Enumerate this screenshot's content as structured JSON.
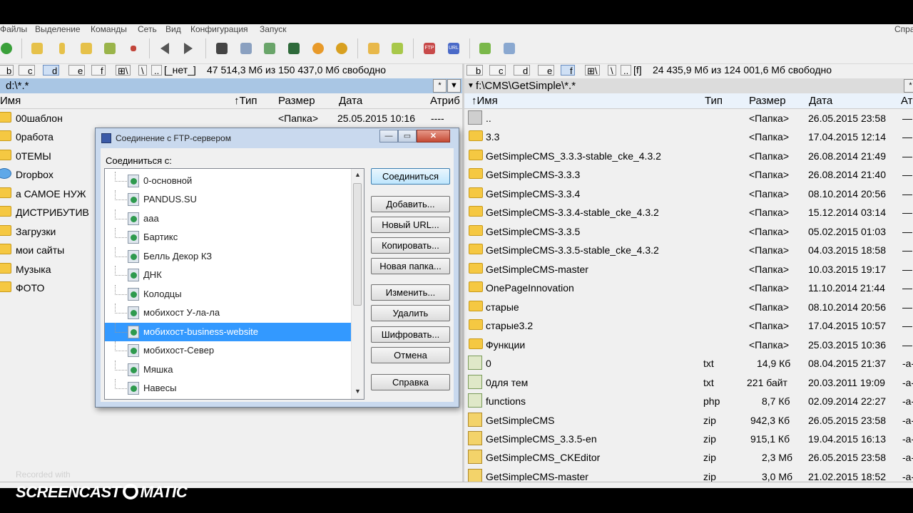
{
  "menu": {
    "items": [
      "Файлы",
      "Выделение",
      "Команды",
      "Сеть",
      "Вид",
      "Конфигурация",
      "Запуск"
    ],
    "right": "Спра"
  },
  "left_panel": {
    "drives": [
      "b",
      "c",
      "d",
      "e",
      "f"
    ],
    "selected_drive": "d",
    "drive_label": "[_нет_]",
    "free_space": "47 514,3 Мб из 150 437,0 Мб свободно",
    "path": "d:\\*.*",
    "history_btn": "*",
    "dropdown_btn": "▼",
    "columns": {
      "name": "Имя",
      "ext": "↑Тип",
      "size": "Размер",
      "date": "Дата",
      "attr": "Атриб"
    },
    "rows": [
      {
        "name": "00шаблон",
        "size": "<Папка>",
        "date": "25.05.2015 10:16",
        "attr": "----"
      },
      {
        "name": "0работа"
      },
      {
        "name": "0ТЕМЫ"
      },
      {
        "name": "Dropbox"
      },
      {
        "name": "а САМОЕ НУЖ"
      },
      {
        "name": "ДИСТРИБУТИВ"
      },
      {
        "name": "Загрузки"
      },
      {
        "name": "мои сайты"
      },
      {
        "name": "Музыка"
      },
      {
        "name": "ФОТО"
      }
    ]
  },
  "right_panel": {
    "drives": [
      "b",
      "c",
      "d",
      "e",
      "f"
    ],
    "selected_drive": "f",
    "drive_label": "[f]",
    "free_space": "24 435,9 Мб из 124 001,6 Мб свободно",
    "path": "f:\\CMS\\GetSimple\\*.*",
    "columns": {
      "name": "↑Имя",
      "ext": "Тип",
      "size": "Размер",
      "date": "Дата",
      "attr": "Ат"
    },
    "rows": [
      {
        "icon": "up",
        "name": "..",
        "ext": "",
        "size": "<Папка>",
        "date": "26.05.2015 23:58",
        "attr": "—"
      },
      {
        "icon": "folder",
        "name": "3.3",
        "ext": "",
        "size": "<Папка>",
        "date": "17.04.2015 12:14",
        "attr": "—"
      },
      {
        "icon": "folder",
        "name": "GetSimpleCMS_3.3.3-stable_cke_4.3.2",
        "ext": "",
        "size": "<Папка>",
        "date": "26.08.2014 21:49",
        "attr": "—"
      },
      {
        "icon": "folder",
        "name": "GetSimpleCMS-3.3.3",
        "ext": "",
        "size": "<Папка>",
        "date": "26.08.2014 21:40",
        "attr": "—"
      },
      {
        "icon": "folder",
        "name": "GetSimpleCMS-3.3.4",
        "ext": "",
        "size": "<Папка>",
        "date": "08.10.2014 20:56",
        "attr": "—"
      },
      {
        "icon": "folder",
        "name": "GetSimpleCMS-3.3.4-stable_cke_4.3.2",
        "ext": "",
        "size": "<Папка>",
        "date": "15.12.2014 03:14",
        "attr": "—"
      },
      {
        "icon": "folder",
        "name": "GetSimpleCMS-3.3.5",
        "ext": "",
        "size": "<Папка>",
        "date": "05.02.2015 01:03",
        "attr": "—"
      },
      {
        "icon": "folder",
        "name": "GetSimpleCMS-3.3.5-stable_cke_4.3.2",
        "ext": "",
        "size": "<Папка>",
        "date": "04.03.2015 18:58",
        "attr": "—"
      },
      {
        "icon": "folder",
        "name": "GetSimpleCMS-master",
        "ext": "",
        "size": "<Папка>",
        "date": "10.03.2015 19:17",
        "attr": "—"
      },
      {
        "icon": "folder",
        "name": "OnePageInnovation",
        "ext": "",
        "size": "<Папка>",
        "date": "11.10.2014 21:44",
        "attr": "—"
      },
      {
        "icon": "folder",
        "name": "старые",
        "ext": "",
        "size": "<Папка>",
        "date": "08.10.2014 20:56",
        "attr": "—"
      },
      {
        "icon": "folder",
        "name": "старые3.2",
        "ext": "",
        "size": "<Папка>",
        "date": "17.04.2015 10:57",
        "attr": "—"
      },
      {
        "icon": "folder",
        "name": "Функции",
        "ext": "",
        "size": "<Папка>",
        "date": "25.03.2015 10:36",
        "attr": "—"
      },
      {
        "icon": "file",
        "name": "0",
        "ext": "txt",
        "size": "14,9 Кб",
        "date": "08.04.2015 21:37",
        "attr": "-a-"
      },
      {
        "icon": "file",
        "name": "0для тем",
        "ext": "txt",
        "size": "221 байт",
        "date": "20.03.2011 19:09",
        "attr": "-a-"
      },
      {
        "icon": "file",
        "name": "functions",
        "ext": "php",
        "size": "8,7 Кб",
        "date": "02.09.2014 22:27",
        "attr": "-a-"
      },
      {
        "icon": "zip",
        "name": "GetSimpleCMS",
        "ext": "zip",
        "size": "942,3 Кб",
        "date": "26.05.2015 23:58",
        "attr": "-a-"
      },
      {
        "icon": "zip",
        "name": "GetSimpleCMS_3.3.5-en",
        "ext": "zip",
        "size": "915,1 Кб",
        "date": "19.04.2015 16:13",
        "attr": "-a-"
      },
      {
        "icon": "zip",
        "name": "GetSimpleCMS_CKEditor",
        "ext": "zip",
        "size": "2,3 Мб",
        "date": "26.05.2015 23:58",
        "attr": "-a-"
      },
      {
        "icon": "zip",
        "name": "GetSimpleCMS-master",
        "ext": "zip",
        "size": "3,0 Мб",
        "date": "21.02.2015 18:52",
        "attr": "-a-"
      }
    ]
  },
  "dialog": {
    "title": "Соединение с FTP-сервером",
    "label": "Соединиться с:",
    "connections": [
      "0-основной",
      "PANDUS.SU",
      "aaa",
      "Бартикс",
      "Белль Декор КЗ",
      "ДНК",
      "Колодцы",
      "мобихост У-ла-ла",
      "мобихост-business-website",
      "мобихост-Север",
      "Мяшка",
      "Навесы"
    ],
    "selected_index": 8,
    "buttons": {
      "connect": "Соединиться",
      "add": "Добавить...",
      "new_url": "Новый URL...",
      "copy": "Копировать...",
      "new_folder": "Новая папка...",
      "edit": "Изменить...",
      "delete": "Удалить",
      "encrypt": "Шифровать...",
      "cancel": "Отмена",
      "help": "Справка"
    },
    "win_buttons": {
      "minimize": "—",
      "maximize": "▭",
      "close": "✕"
    }
  },
  "watermark": {
    "line1": "Recorded with",
    "line2a": "SCREENCAST",
    "line2b": "MATIC"
  }
}
